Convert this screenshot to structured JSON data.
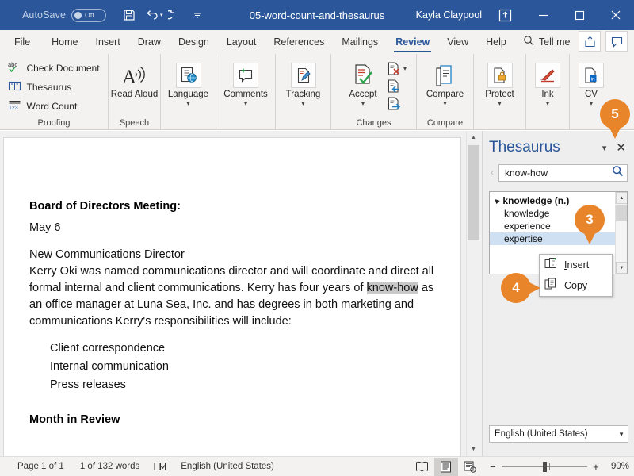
{
  "titlebar": {
    "autosave_label": "AutoSave",
    "autosave_state": "Off",
    "document_title": "05-word-count-and-thesaurus",
    "user_name": "Kayla Claypool",
    "qat": [
      {
        "name": "save-icon",
        "label": "Save"
      },
      {
        "name": "undo-icon",
        "label": "Undo"
      },
      {
        "name": "redo-icon",
        "label": "Redo"
      },
      {
        "name": "customize-quick-access-toolbar-icon",
        "label": "Customize Quick Access Toolbar"
      }
    ],
    "window_buttons": {
      "ribbon_display": "Ribbon Display Options",
      "minimize": "—",
      "maximize": "☐",
      "close": "✕"
    }
  },
  "tabs": [
    {
      "label": "File",
      "active": false
    },
    {
      "label": "Home",
      "active": false
    },
    {
      "label": "Insert",
      "active": false
    },
    {
      "label": "Draw",
      "active": false
    },
    {
      "label": "Design",
      "active": false
    },
    {
      "label": "Layout",
      "active": false
    },
    {
      "label": "References",
      "active": false
    },
    {
      "label": "Mailings",
      "active": false
    },
    {
      "label": "Review",
      "active": true
    },
    {
      "label": "View",
      "active": false
    },
    {
      "label": "Help",
      "active": false
    }
  ],
  "tellme": {
    "label": "Tell me"
  },
  "tab_right_buttons": [
    {
      "name": "share-icon",
      "label": "Share"
    },
    {
      "name": "comments-icon",
      "label": "Comments"
    }
  ],
  "ribbon": {
    "groups": [
      {
        "label": "Proofing",
        "commands": [
          {
            "label": "Check Document",
            "icon": "spelling-check-icon"
          },
          {
            "label": "Thesaurus",
            "icon": "thesaurus-book-icon"
          },
          {
            "label": "Word Count",
            "icon": "word-count-icon"
          }
        ]
      },
      {
        "label": "Speech",
        "commands": [
          {
            "label": "Read Aloud",
            "icon": "read-aloud-icon"
          }
        ]
      },
      {
        "label": "",
        "commands": [
          {
            "label": "Language",
            "icon": "language-icon",
            "caret": "▾"
          }
        ]
      },
      {
        "label": "",
        "commands": [
          {
            "label": "Comments",
            "icon": "new-comment-icon",
            "caret": "▾"
          }
        ]
      },
      {
        "label": "",
        "commands": [
          {
            "label": "Tracking",
            "icon": "track-changes-icon",
            "caret": "▾"
          }
        ]
      },
      {
        "label": "Changes",
        "commands": [
          {
            "label": "Accept",
            "icon": "accept-change-icon",
            "caret": "▾"
          },
          {
            "label": "Reject",
            "icon": "reject-change-icon",
            "caret": "▾"
          },
          {
            "label": "Previous",
            "icon": "previous-change-icon"
          },
          {
            "label": "Next",
            "icon": "next-change-icon"
          }
        ]
      },
      {
        "label": "Compare",
        "commands": [
          {
            "label": "Compare",
            "icon": "compare-documents-icon",
            "caret": "▾"
          }
        ]
      },
      {
        "label": "",
        "commands": [
          {
            "label": "Protect",
            "icon": "protect-lock-icon",
            "caret": "▾"
          }
        ]
      },
      {
        "label": "",
        "commands": [
          {
            "label": "Ink",
            "icon": "ink-pen-icon",
            "caret": "▾"
          }
        ]
      },
      {
        "label": "",
        "commands": [
          {
            "label": "CV",
            "icon": "linkedin-cv-icon",
            "caret": "▾"
          }
        ]
      }
    ]
  },
  "document": {
    "heading": "Board of Directors Meeting:",
    "date": "May 6",
    "subheading": "New Communications Director",
    "body_pre": "Kerry Oki was named communications director and will coordinate and direct all formal internal and client communications. Kerry has four years of ",
    "body_highlight": "know-how",
    "body_post": " as an office manager at Luna Sea, Inc. and has degrees in both marketing and communications Kerry's responsibilities will include:",
    "bullets": [
      "Client correspondence",
      "Internal communication",
      "Press releases"
    ],
    "section_heading": "Month in Review"
  },
  "thesaurus_pane": {
    "title": "Thesaurus",
    "caret": "▾",
    "close": "✕",
    "back_arrow": "‹",
    "search_value": "know-how",
    "search_icon": "search-icon",
    "results": [
      {
        "label": "knowledge (n.)",
        "type": "group",
        "selected": false
      },
      {
        "label": "knowledge",
        "type": "synonym",
        "selected": false
      },
      {
        "label": "experience",
        "type": "synonym",
        "selected": false
      },
      {
        "label": "expertise",
        "type": "synonym",
        "selected": true
      }
    ],
    "language_value": "English (United States)"
  },
  "context_menu": {
    "items": [
      {
        "label": "Insert",
        "accel": "I",
        "rest": "nsert",
        "icon": "insert-icon"
      },
      {
        "label": "Copy",
        "accel": "C",
        "rest": "opy",
        "icon": "copy-icon"
      }
    ]
  },
  "statusbar": {
    "page": "Page 1 of 1",
    "words": "1 of 132 words",
    "proofing_icon": "proofing-status-icon",
    "language": "English (United States)",
    "view_buttons": [
      {
        "name": "read-mode-icon",
        "active": false
      },
      {
        "name": "print-layout-icon",
        "active": true
      },
      {
        "name": "web-layout-icon",
        "active": false
      }
    ],
    "zoom_minus": "−",
    "zoom_plus": "+",
    "zoom_value": "90%"
  },
  "callouts": [
    {
      "number": "5",
      "direction": "down"
    },
    {
      "number": "3",
      "direction": "down"
    },
    {
      "number": "4",
      "direction": "left"
    }
  ],
  "colors": {
    "title_bar": "#2b579a",
    "accent": "#2b579a",
    "ribbon_bg": "#f3f2f1",
    "callout": "#e8852a",
    "selection": "#cfe0f3",
    "highlight": "#c8c8c8"
  }
}
